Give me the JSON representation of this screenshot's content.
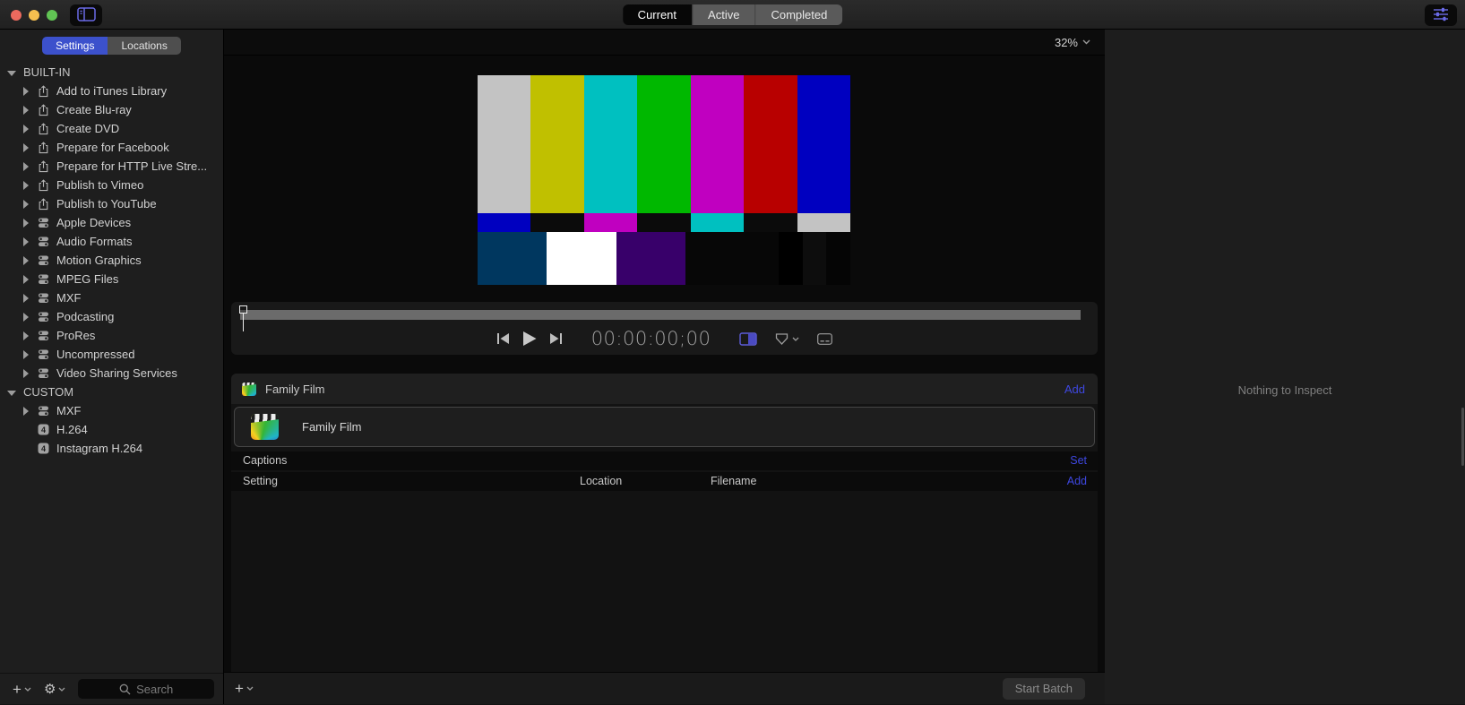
{
  "titlebar": {
    "segments": [
      "Current",
      "Active",
      "Completed"
    ],
    "active_segment": "Current"
  },
  "sidebar": {
    "tabs": [
      {
        "label": "Settings",
        "active": true
      },
      {
        "label": "Locations",
        "active": false
      }
    ],
    "sections": [
      {
        "label": "BUILT-IN",
        "items": [
          {
            "label": "Add to iTunes Library",
            "icon": "share-icon",
            "disclosure": true
          },
          {
            "label": "Create Blu-ray",
            "icon": "share-icon",
            "disclosure": true
          },
          {
            "label": "Create DVD",
            "icon": "share-icon",
            "disclosure": true
          },
          {
            "label": "Prepare for Facebook",
            "icon": "share-icon",
            "disclosure": true
          },
          {
            "label": "Prepare for HTTP Live Stre...",
            "icon": "share-icon",
            "disclosure": true
          },
          {
            "label": "Publish to Vimeo",
            "icon": "share-icon",
            "disclosure": true
          },
          {
            "label": "Publish to YouTube",
            "icon": "share-icon",
            "disclosure": true
          },
          {
            "label": "Apple Devices",
            "icon": "setting-group-icon",
            "disclosure": true
          },
          {
            "label": "Audio Formats",
            "icon": "setting-group-icon",
            "disclosure": true
          },
          {
            "label": "Motion Graphics",
            "icon": "setting-group-icon",
            "disclosure": true
          },
          {
            "label": "MPEG Files",
            "icon": "setting-group-icon",
            "disclosure": true
          },
          {
            "label": "MXF",
            "icon": "setting-group-icon",
            "disclosure": true
          },
          {
            "label": "Podcasting",
            "icon": "setting-group-icon",
            "disclosure": true
          },
          {
            "label": "ProRes",
            "icon": "setting-group-icon",
            "disclosure": true
          },
          {
            "label": "Uncompressed",
            "icon": "setting-group-icon",
            "disclosure": true
          },
          {
            "label": "Video Sharing Services",
            "icon": "setting-group-icon",
            "disclosure": true
          }
        ]
      },
      {
        "label": "CUSTOM",
        "items": [
          {
            "label": "MXF",
            "icon": "setting-group-icon",
            "disclosure": true
          },
          {
            "label": "H.264",
            "icon": "h264-badge-icon",
            "disclosure": false
          },
          {
            "label": "Instagram H.264",
            "icon": "h264-badge-icon",
            "disclosure": false
          }
        ]
      }
    ],
    "search_placeholder": "Search"
  },
  "preview": {
    "zoom_level": "32%",
    "timecode": "00:00:00;00",
    "smpte_bars": {
      "top": [
        "#c3c3c3",
        "#c0c000",
        "#00c0c0",
        "#00b800",
        "#c000c0",
        "#b80000",
        "#0000c0"
      ],
      "middle": [
        "#0000c0",
        "#0b0b0b",
        "#c000c0",
        "#0b0b0b",
        "#00c0c0",
        "#0b0b0b",
        "#c3c3c3"
      ],
      "bottom": [
        {
          "color": "#00375f",
          "w": 18.6
        },
        {
          "color": "#ffffff",
          "w": 18.6
        },
        {
          "color": "#38006a",
          "w": 18.6
        },
        {
          "color": "#070707",
          "w": 25.0
        },
        {
          "color": "#000000",
          "w": 6.4
        },
        {
          "color": "#0d0d0d",
          "w": 6.4
        },
        {
          "color": "#050505",
          "w": 6.4
        }
      ]
    }
  },
  "batch": {
    "header_title": "Family Film",
    "header_action": "Add",
    "job_title": "Family Film",
    "captions_label": "Captions",
    "captions_action": "Set",
    "columns": [
      "Setting",
      "Location",
      "Filename"
    ],
    "setting_action": "Add",
    "start_batch_label": "Start Batch"
  },
  "inspector": {
    "empty_text": "Nothing to Inspect"
  },
  "colors": {
    "accent_link_blue": "#3e47e0",
    "tab_selected_blue": "#3c51cc",
    "toolbar_icon_blue": "#6b6be8",
    "traffic_red": "#ec6a5e",
    "traffic_yellow": "#f5bf4f",
    "traffic_green": "#61c454"
  }
}
